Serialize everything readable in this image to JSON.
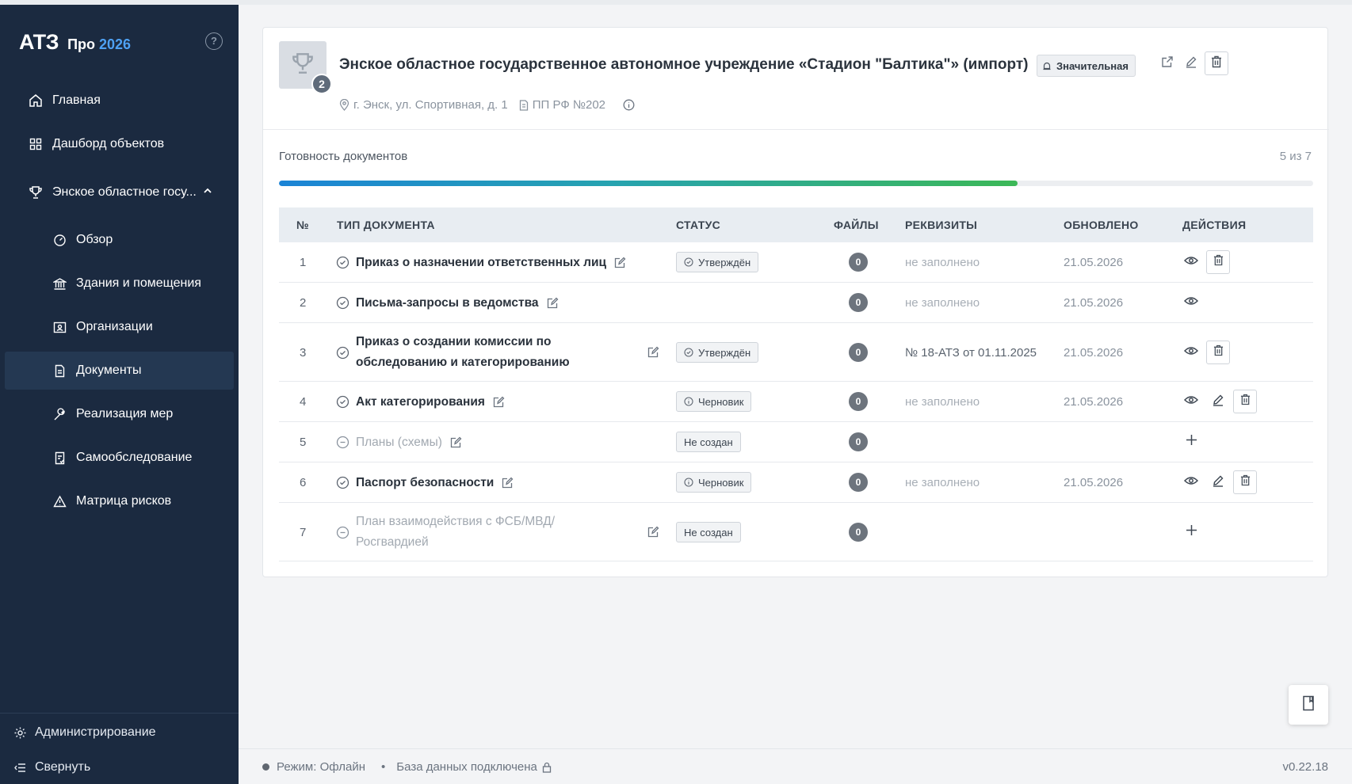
{
  "app": {
    "logo": "АТЗ",
    "edition": "Про",
    "year": "2026",
    "accent": "#4ea1f3"
  },
  "sidebar": {
    "items": [
      {
        "label": "Главная",
        "icon": "home-icon"
      },
      {
        "label": "Дашборд объектов",
        "icon": "grid-icon"
      },
      {
        "label": "Энское областное госу...",
        "icon": "trophy-icon",
        "expanded": true
      },
      {
        "label": "Обзор",
        "icon": "gauge-icon"
      },
      {
        "label": "Здания и помещения",
        "icon": "bank-icon"
      },
      {
        "label": "Организации",
        "icon": "id-card-icon"
      },
      {
        "label": "Документы",
        "icon": "document-icon",
        "active": true
      },
      {
        "label": "Реализация мер",
        "icon": "wrench-icon"
      },
      {
        "label": "Самообследование",
        "icon": "checklist-icon"
      },
      {
        "label": "Матрица рисков",
        "icon": "warning-icon"
      }
    ],
    "admin_label": "Администрирование",
    "collapse_label": "Свернуть"
  },
  "object": {
    "badge_count": "2",
    "title": "Энское областное государственное автономное учреждение «Стадион \"Балтика\"» (импорт)",
    "category": "Значительная",
    "address": "г. Энск, ул. Спортивная, д. 1",
    "regulation": "ПП РФ №202"
  },
  "readiness": {
    "label": "Готовность документов",
    "count": "5 из 7",
    "fraction": 0.714
  },
  "table": {
    "headers": [
      "№",
      "ТИП ДОКУМЕНТА",
      "СТАТУС",
      "ФАЙЛЫ",
      "РЕКВИЗИТЫ",
      "ОБНОВЛЕНО",
      "ДЕЙСТВИЯ"
    ],
    "rows": [
      {
        "num": "1",
        "name": "Приказ о назначении ответственных лиц",
        "status": "Утверждён",
        "files": "0",
        "req": "не заполнено",
        "updated": "21.05.2026"
      },
      {
        "num": "2",
        "name": "Письма-запросы в ведомства",
        "status": "",
        "files": "0",
        "req": "не заполнено",
        "updated": "21.05.2026"
      },
      {
        "num": "3",
        "name_line1": "Приказ о создании комиссии по",
        "name_line2": "обследованию и категорированию",
        "status": "Утверждён",
        "files": "0",
        "req": "№ 18-АТЗ от 01.11.2025",
        "updated": "21.05.2026"
      },
      {
        "num": "4",
        "name": "Акт категорирования",
        "status": "Черновик",
        "files": "0",
        "req": "не заполнено",
        "updated": "21.05.2026"
      },
      {
        "num": "5",
        "name": "Планы (схемы)",
        "status": "Не создан",
        "files": "0",
        "req": "",
        "updated": ""
      },
      {
        "num": "6",
        "name": "Паспорт безопасности",
        "status": "Черновик",
        "files": "0",
        "req": "не заполнено",
        "updated": "21.05.2026"
      },
      {
        "num": "7",
        "name_line1": "План взаимодействия с ФСБ/МВД/",
        "name_line2": "Росгвардией",
        "status": "Не создан",
        "files": "0",
        "req": "",
        "updated": ""
      }
    ]
  },
  "statusbar": {
    "mode": "Режим: Офлайн",
    "db": "База данных подключена",
    "version": "v0.22.18"
  }
}
